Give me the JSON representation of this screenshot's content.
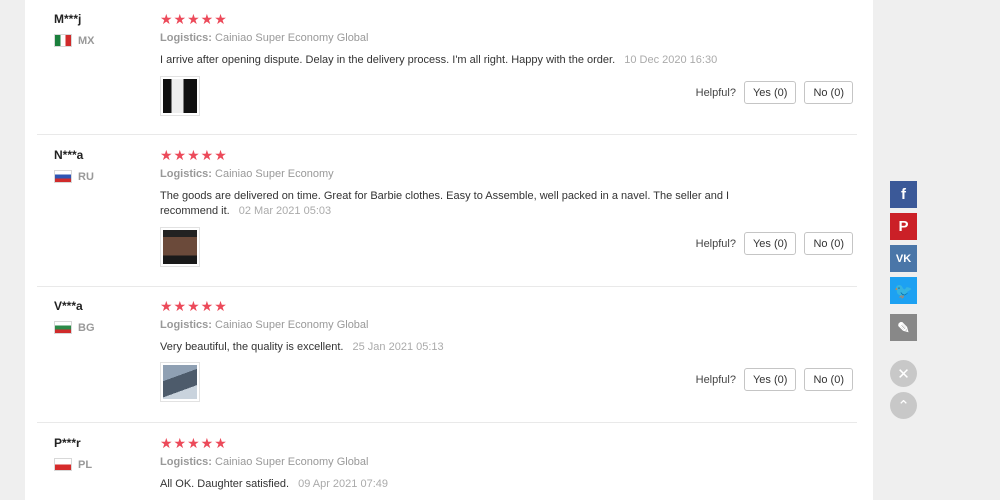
{
  "reviews": [
    {
      "user": "M***j",
      "country_code": "MX",
      "stars": "★★★★★",
      "rating": 5,
      "logistics_label": "Logistics:",
      "logistics": "Cainiao Super Economy Global",
      "text": "I arrive after opening dispute. Delay in the delivery process. I'm all right. Happy with the order.",
      "date": "10 Dec 2020 16:30",
      "helpful_label": "Helpful?",
      "yes_label": "Yes (0)",
      "no_label": "No (0)"
    },
    {
      "user": "N***a",
      "country_code": "RU",
      "stars": "★★★★★",
      "rating": 5,
      "logistics_label": "Logistics:",
      "logistics": "Cainiao Super Economy",
      "text": "The goods are delivered on time. Great for Barbie clothes. Easy to Assemble, well packed in a navel. The seller and I recommend it.",
      "date": "02 Mar 2021 05:03",
      "helpful_label": "Helpful?",
      "yes_label": "Yes (0)",
      "no_label": "No (0)"
    },
    {
      "user": "V***a",
      "country_code": "BG",
      "stars": "★★★★★",
      "rating": 5,
      "logistics_label": "Logistics:",
      "logistics": "Cainiao Super Economy Global",
      "text": "Very beautiful, the quality is excellent.",
      "date": "25 Jan 2021 05:13",
      "helpful_label": "Helpful?",
      "yes_label": "Yes (0)",
      "no_label": "No (0)"
    },
    {
      "user": "P***r",
      "country_code": "PL",
      "stars": "★★★★★",
      "rating": 5,
      "logistics_label": "Logistics:",
      "logistics": "Cainiao Super Economy Global",
      "text": "All OK. Daughter satisfied.",
      "date": "09 Apr 2021 07:49"
    }
  ],
  "social": {
    "facebook_glyph": "f",
    "pinterest_glyph": "P",
    "vk_glyph": "VK",
    "twitter_glyph": "🐦",
    "edit_glyph": "✎",
    "close_glyph": "✕",
    "top_glyph": "⌃"
  },
  "icons": {
    "facebook": "facebook-icon",
    "pinterest": "pinterest-icon",
    "vk": "vk-icon",
    "twitter": "twitter-icon",
    "edit": "edit-icon",
    "close": "close-icon",
    "scroll_top": "scroll-top-icon"
  },
  "colors": {
    "star": "#ec4a5a",
    "facebook": "#3b5998",
    "pinterest": "#cb2027",
    "vk": "#4a76a8",
    "twitter": "#1da1f2"
  }
}
